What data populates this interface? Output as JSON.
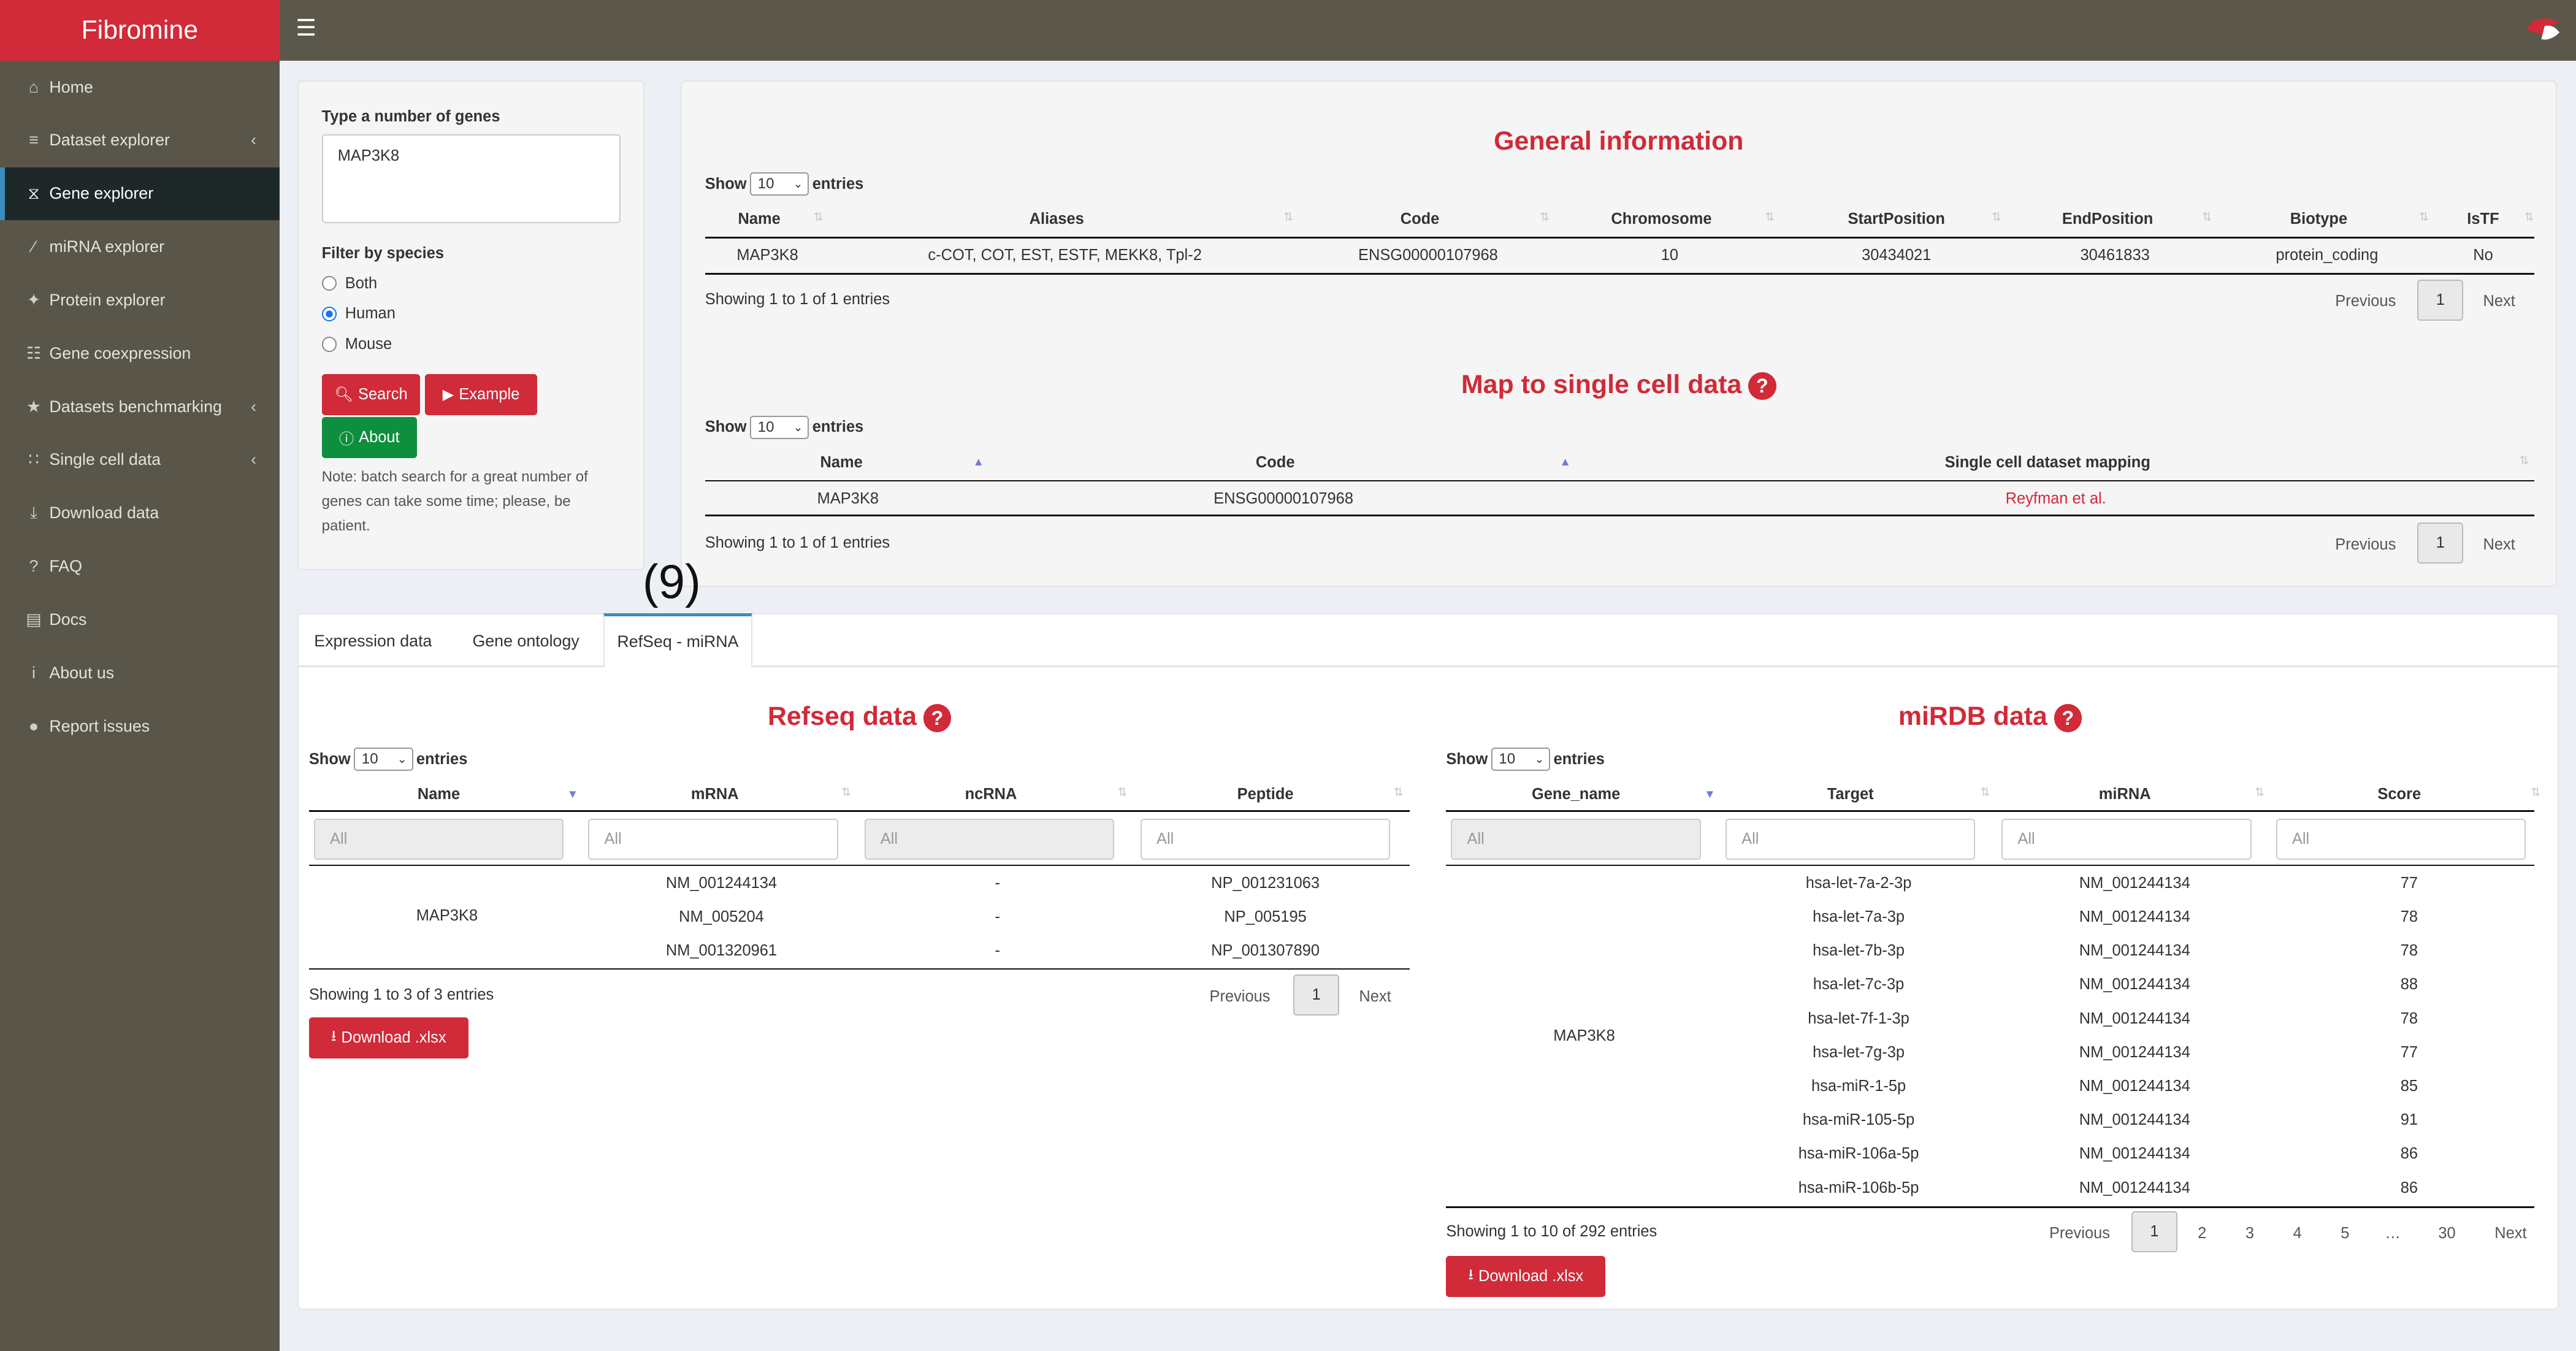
{
  "app": {
    "title": "Fibromine",
    "menu_icon": "hamburger-icon"
  },
  "sidebar": {
    "items": [
      {
        "label": "Home",
        "icon": "home-icon",
        "has_chevron": false,
        "active": false
      },
      {
        "label": "Dataset explorer",
        "icon": "database-icon",
        "has_chevron": true,
        "active": false
      },
      {
        "label": "Gene explorer",
        "icon": "dna-icon",
        "has_chevron": false,
        "active": true
      },
      {
        "label": "miRNA explorer",
        "icon": "syringe-icon",
        "has_chevron": false,
        "active": false
      },
      {
        "label": "Protein explorer",
        "icon": "network-icon",
        "has_chevron": false,
        "active": false
      },
      {
        "label": "Gene coexpression",
        "icon": "sitemap-icon",
        "has_chevron": false,
        "active": false
      },
      {
        "label": "Datasets benchmarking",
        "icon": "star-icon",
        "has_chevron": true,
        "active": false
      },
      {
        "label": "Single cell data",
        "icon": "grid-dots-icon",
        "has_chevron": true,
        "active": false
      },
      {
        "label": "Download data",
        "icon": "download-icon",
        "has_chevron": false,
        "active": false
      },
      {
        "label": "FAQ",
        "icon": "question-icon",
        "has_chevron": false,
        "active": false
      },
      {
        "label": "Docs",
        "icon": "book-icon",
        "has_chevron": false,
        "active": false
      },
      {
        "label": "About us",
        "icon": "info-icon",
        "has_chevron": false,
        "active": false
      },
      {
        "label": "Report issues",
        "icon": "github-icon",
        "has_chevron": false,
        "active": false
      }
    ]
  },
  "search_panel": {
    "genes_label": "Type a number of genes",
    "genes_value": "MAP3K8",
    "species_label": "Filter by species",
    "species_options": [
      "Both",
      "Human",
      "Mouse"
    ],
    "species_selected": "Human",
    "search_button": "Search",
    "example_button": "Example",
    "about_button": "About",
    "note_lines": [
      "Note: batch search for a great number of",
      "genes can take some time; please, be",
      "patient."
    ]
  },
  "general_info": {
    "title": "General information",
    "show_label": "Show",
    "entries_value": "10",
    "entries_label": "entries",
    "columns": [
      "Name",
      "Aliases",
      "Code",
      "Chromosome",
      "StartPosition",
      "EndPosition",
      "Biotype",
      "IsTF"
    ],
    "rows": [
      [
        "MAP3K8",
        "c-COT, COT, EST, ESTF, MEKK8, Tpl-2",
        "ENSG00000107968",
        "10",
        "30434021",
        "30461833",
        "protein_coding",
        "No"
      ]
    ],
    "info": "Showing 1 to 1 of 1 entries",
    "prev": "Previous",
    "page": "1",
    "next": "Next"
  },
  "single_cell": {
    "title": "Map to single cell data",
    "show_label": "Show",
    "entries_value": "10",
    "entries_label": "entries",
    "columns": [
      "Name",
      "Code",
      "Single cell dataset mapping"
    ],
    "rows": [
      [
        "MAP3K8",
        "ENSG00000107968",
        "Reyfman et al."
      ]
    ],
    "info": "Showing 1 to 1 of 1 entries",
    "prev": "Previous",
    "page": "1",
    "next": "Next"
  },
  "annotation": "(9)",
  "tabs": [
    "Expression data",
    "Gene ontology",
    "RefSeq - miRNA"
  ],
  "active_tab": "RefSeq - miRNA",
  "refseq": {
    "title": "Refseq data",
    "show_label": "Show",
    "entries_value": "10",
    "entries_label": "entries",
    "columns": [
      "Name",
      "mRNA",
      "ncRNA",
      "Peptide"
    ],
    "filter_placeholder": "All",
    "gene": "MAP3K8",
    "rows": [
      [
        "NM_001244134",
        "-",
        "NP_001231063"
      ],
      [
        "NM_005204",
        "-",
        "NP_005195"
      ],
      [
        "NM_001320961",
        "-",
        "NP_001307890"
      ]
    ],
    "info": "Showing 1 to 3 of 3 entries",
    "prev": "Previous",
    "page": "1",
    "next": "Next",
    "download": "Download .xlsx"
  },
  "mirdb": {
    "title": "miRDB data",
    "show_label": "Show",
    "entries_value": "10",
    "entries_label": "entries",
    "columns": [
      "Gene_name",
      "Target",
      "miRNA",
      "Score"
    ],
    "filter_placeholder": "All",
    "gene": "MAP3K8",
    "rows": [
      [
        "hsa-let-7a-2-3p",
        "NM_001244134",
        "77"
      ],
      [
        "hsa-let-7a-3p",
        "NM_001244134",
        "78"
      ],
      [
        "hsa-let-7b-3p",
        "NM_001244134",
        "78"
      ],
      [
        "hsa-let-7c-3p",
        "NM_001244134",
        "88"
      ],
      [
        "hsa-let-7f-1-3p",
        "NM_001244134",
        "78"
      ],
      [
        "hsa-let-7g-3p",
        "NM_001244134",
        "77"
      ],
      [
        "hsa-miR-1-5p",
        "NM_001244134",
        "85"
      ],
      [
        "hsa-miR-105-5p",
        "NM_001244134",
        "91"
      ],
      [
        "hsa-miR-106a-5p",
        "NM_001244134",
        "86"
      ],
      [
        "hsa-miR-106b-5p",
        "NM_001244134",
        "86"
      ]
    ],
    "info": "Showing 1 to 10 of 292 entries",
    "prev": "Previous",
    "pages": [
      "1",
      "2",
      "3",
      "4",
      "5",
      "…",
      "30"
    ],
    "next": "Next",
    "download": "Download .xlsx"
  }
}
